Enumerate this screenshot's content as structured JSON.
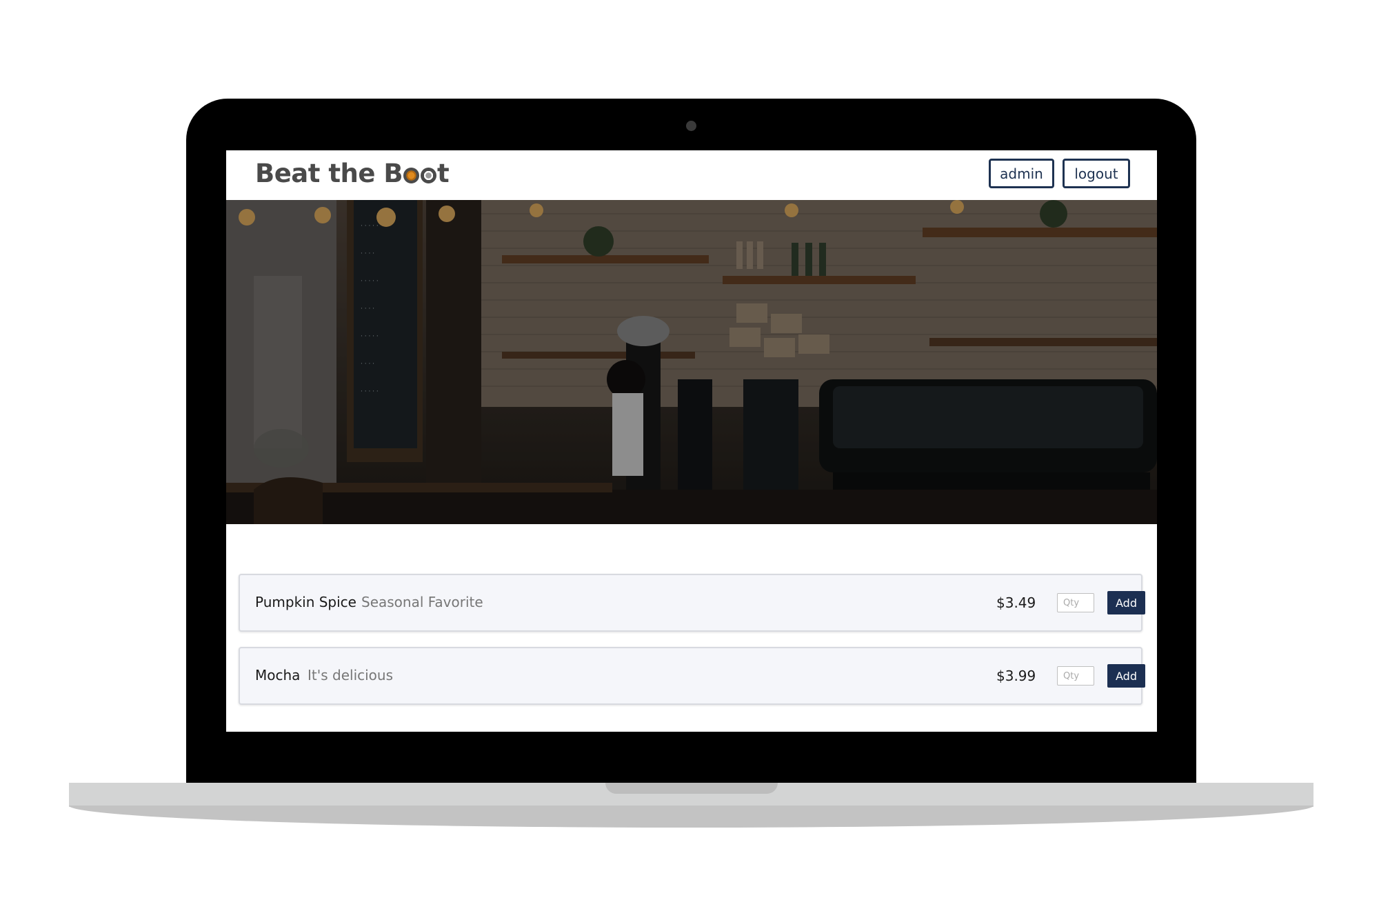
{
  "app": {
    "brand_prefix": "Beat the B",
    "brand_suffix": "t"
  },
  "nav": {
    "admin_label": "admin",
    "logout_label": "logout"
  },
  "menu": {
    "items": [
      {
        "name": "Pumpkin Spice",
        "description": "Seasonal Favorite",
        "price": "$3.49",
        "qty_placeholder": "Qty",
        "add_label": "Add"
      },
      {
        "name": "Mocha",
        "description": "It's delicious",
        "price": "$3.99",
        "qty_placeholder": "Qty",
        "add_label": "Add"
      }
    ]
  },
  "colors": {
    "primary": "#1c2f52",
    "brand_text": "#4a4a4a",
    "card_bg": "#f5f6fa"
  }
}
